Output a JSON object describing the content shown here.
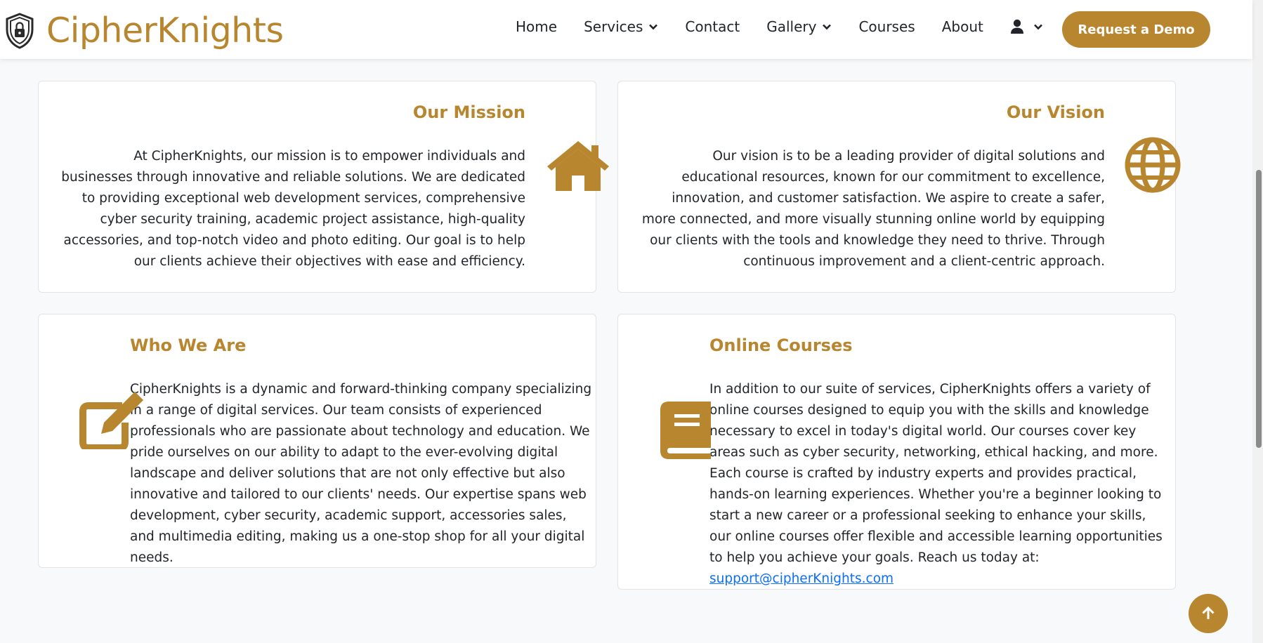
{
  "brand": {
    "name": "CipherKnights",
    "logo_icon": "shield-lock-icon"
  },
  "nav": {
    "items": [
      {
        "label": "Home",
        "dropdown": false
      },
      {
        "label": "Services",
        "dropdown": true
      },
      {
        "label": "Contact",
        "dropdown": false
      },
      {
        "label": "Gallery",
        "dropdown": true
      },
      {
        "label": "Courses",
        "dropdown": false
      },
      {
        "label": "About",
        "dropdown": false
      }
    ],
    "user_icon": "user-icon",
    "cta_label": "Request a Demo"
  },
  "colors": {
    "accent": "#b8862f",
    "link": "#0d6efd",
    "text": "#212529",
    "page_bg": "#f8f9fa"
  },
  "cards": {
    "mission": {
      "title": "Our Mission",
      "icon": "home-icon",
      "text": "At CipherKnights, our mission is to empower individuals and businesses through innovative and reliable solutions. We are dedicated to providing exceptional web development services, comprehensive cyber security training, academic project assistance, high-quality accessories, and top-notch video and photo editing. Our goal is to help our clients achieve their objectives with ease and efficiency."
    },
    "vision": {
      "title": "Our Vision",
      "icon": "globe-icon",
      "text": "Our vision is to be a leading provider of digital solutions and educational resources, known for our commitment to excellence, innovation, and customer satisfaction. We aspire to create a safer, more connected, and more visually stunning online world by equipping our clients with the tools and knowledge they need to thrive. Through continuous improvement and a client-centric approach."
    },
    "who": {
      "title": "Who We Are",
      "icon": "edit-icon",
      "text": "CipherKnights is a dynamic and forward-thinking company specializing in a range of digital services. Our team consists of experienced professionals who are passionate about technology and education. We pride ourselves on our ability to adapt to the ever-evolving digital landscape and deliver solutions that are not only effective but also innovative and tailored to our clients' needs. Our expertise spans web development, cyber security, academic support, accessories sales, and multimedia editing, making us a one-stop shop for all your digital needs."
    },
    "courses": {
      "title": "Online Courses",
      "icon": "book-icon",
      "text": "In addition to our suite of services, CipherKnights offers a variety of online courses designed to equip you with the skills and knowledge necessary to excel in today's digital world. Our courses cover key areas such as cyber security, networking, ethical hacking, and more. Each course is crafted by industry experts and provides practical, hands-on learning experiences. Whether you're a beginner looking to start a new career or a professional seeking to enhance your skills, our online courses offer flexible and accessible learning opportunities to help you achieve your goals. Reach us today at: ",
      "email": "support@cipherKnights.com"
    }
  },
  "back_to_top_icon": "arrow-up-icon"
}
